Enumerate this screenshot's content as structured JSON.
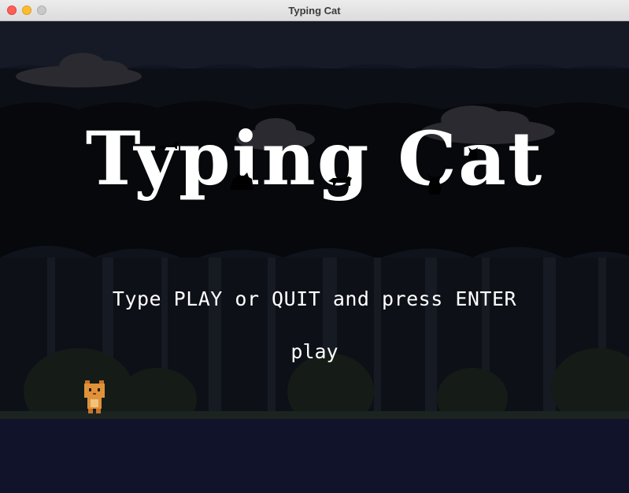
{
  "window": {
    "title": "Typing Cat"
  },
  "game": {
    "title": "Typing Cat",
    "instruction": "Type PLAY or QUIT and press ENTER",
    "typed_input": "play",
    "player_sprite": "orange-cat-sprite"
  },
  "colors": {
    "sky": "#0b0c14",
    "ground": "#10132a",
    "text": "#ffffff",
    "cat_orange": "#e0923a"
  }
}
